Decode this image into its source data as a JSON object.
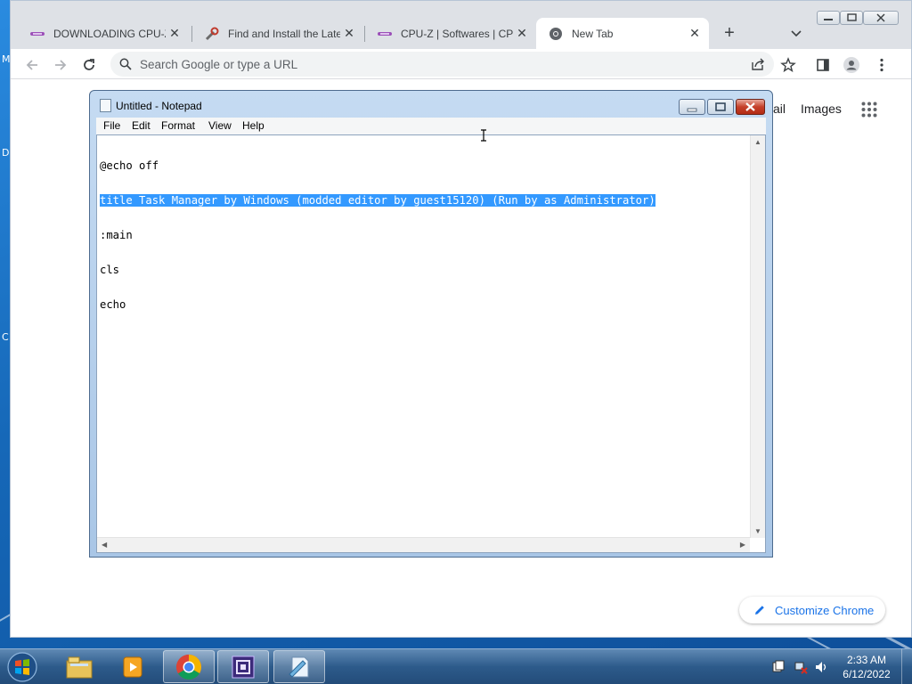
{
  "desktop": {
    "edge_chars": [
      "M",
      "D",
      "C"
    ]
  },
  "chrome": {
    "tabs": [
      {
        "title": "DOWNLOADING CPU-Z",
        "favicon": "cpuid-icon"
      },
      {
        "title": "Find and Install the Late",
        "favicon": "tools-icon"
      },
      {
        "title": "CPU-Z | Softwares | CPU",
        "favicon": "cpuid-icon"
      },
      {
        "title": "New Tab",
        "favicon": "chrome-icon",
        "active": true
      }
    ],
    "omnibox_placeholder": "Search Google or type a URL",
    "ntp_links": {
      "gmail": "ail",
      "images": "Images"
    },
    "customize_label": "Customize Chrome"
  },
  "notepad": {
    "title": "Untitled - Notepad",
    "menu": [
      "File",
      "Edit",
      "Format",
      "View",
      "Help"
    ],
    "lines": [
      "@echo off",
      "title Task Manager by Windows (modded editor by guest15120) (Run by as Administrator)",
      ":main",
      "cls",
      "echo"
    ],
    "selected_line": 1
  },
  "taskbar": {
    "apps": [
      "file-explorer-icon",
      "media-player-icon",
      "chrome-icon",
      "app-icon",
      "notepad-icon"
    ],
    "clock": {
      "time": "2:33 AM",
      "date": "6/12/2022"
    }
  },
  "colors": {
    "selection": "#3399ff",
    "accent": "#1a73e8"
  }
}
